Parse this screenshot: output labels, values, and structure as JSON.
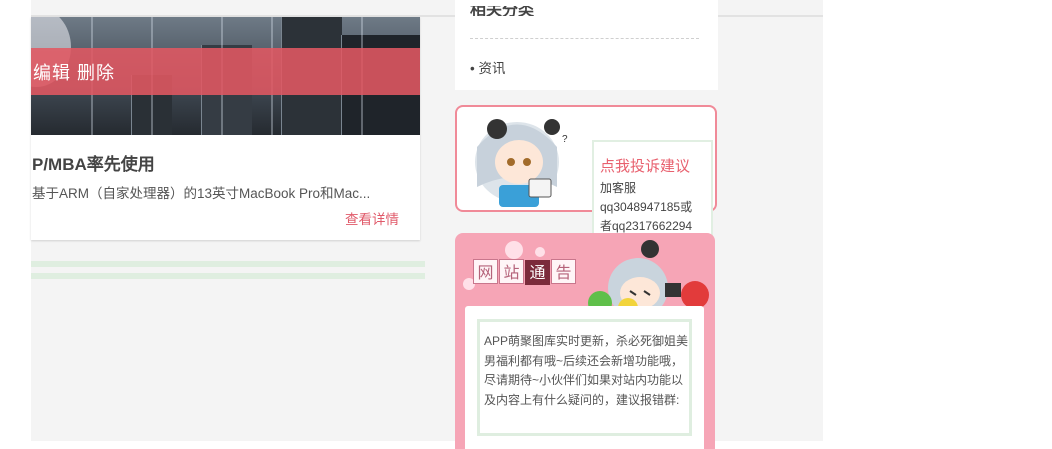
{
  "article": {
    "actions": "编辑 删除",
    "title": "P/MBA率先使用",
    "desc": "基于ARM（自家处理器）的13英寸MacBook Pro和Mac...",
    "more": "查看详情"
  },
  "related": {
    "title": "相关分类",
    "items": [
      "• 资讯"
    ]
  },
  "complaint": {
    "link": "点我投诉建议",
    "line1": "加客服",
    "line2": "qq3048947185或",
    "line3": "者qq2317662294"
  },
  "notice": {
    "title_chars": [
      "网",
      "站",
      "通",
      "告"
    ],
    "text": "APP萌聚图库实时更新，杀必死御姐美男福利都有哦~后续还会新增功能哦，尽请期待~小伙伴们如果对站内功能以及内容上有什么疑问的，建议报错群:"
  },
  "colors": {
    "accent": "#e05a6a",
    "overlay": "#e15862",
    "notice_bg": "#f6a5b6",
    "divider": "#dfeee0"
  }
}
